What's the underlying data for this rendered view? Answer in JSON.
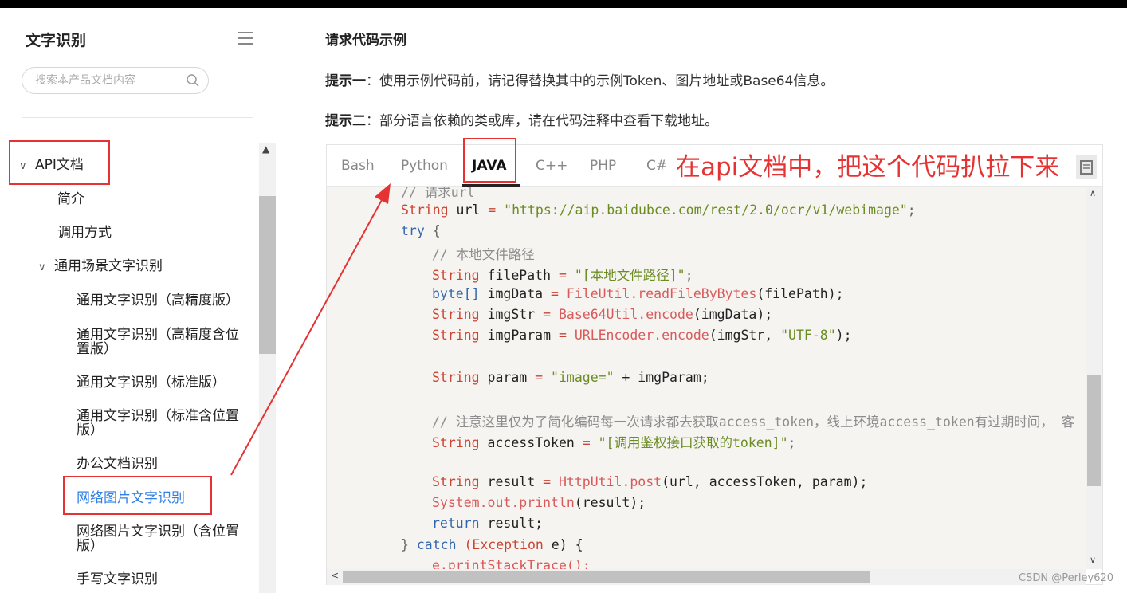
{
  "sidebar": {
    "title": "文字识别",
    "search_placeholder": "搜索本产品文档内容",
    "items": [
      {
        "label": "API文档"
      },
      {
        "label": "简介"
      },
      {
        "label": "调用方式"
      },
      {
        "label": "通用场景文字识别"
      },
      {
        "label": "通用文字识别（高精度版）"
      },
      {
        "label": "通用文字识别（高精度含位"
      },
      {
        "label": "置版）"
      },
      {
        "label": "通用文字识别（标准版）"
      },
      {
        "label": "通用文字识别（标准含位置"
      },
      {
        "label": "版）"
      },
      {
        "label": "办公文档识别"
      },
      {
        "label": "网络图片文字识别"
      },
      {
        "label": "网络图片文字识别（含位置"
      },
      {
        "label": "版）"
      },
      {
        "label": "手写文字识别"
      }
    ]
  },
  "main": {
    "section_title": "请求代码示例",
    "tip1_label": "提示一",
    "tip1_text": "：使用示例代码前，请记得替换其中的示例Token、图片地址或Base64信息。",
    "tip2_label": "提示二",
    "tip2_text": "：部分语言依赖的类或库，请在代码注释中查看下载地址。",
    "tabs": [
      "Bash",
      "Python",
      "JAVA",
      "C++",
      "PHP",
      "C#"
    ],
    "active_tab": "JAVA"
  },
  "code": {
    "l1": "// 请求url",
    "l2_type": "String",
    "l2_var": " url ",
    "l2_op": "=",
    "l2_str": " \"https://aip.baidubce.com/rest/2.0/ocr/v1/webimage\"",
    "l2_end": ";",
    "l3_kw": "try",
    "l3_end": " {",
    "l4": "// 本地文件路径",
    "l5_type": "String",
    "l5_var": " filePath ",
    "l5_op": "=",
    "l5_str": " \"[本地文件路径]\"",
    "l5_end": ";",
    "l6_type": "byte[]",
    "l6_var": " imgData ",
    "l6_op": "=",
    "l6_fn": " FileUtil.readFileByBytes",
    "l6_arg": "(filePath);",
    "l7_type": "String",
    "l7_var": " imgStr ",
    "l7_op": "=",
    "l7_fn": " Base64Util.encode",
    "l7_arg": "(imgData);",
    "l8_type": "String",
    "l8_var": " imgParam ",
    "l8_op": "=",
    "l8_fn": " URLEncoder.encode",
    "l8_arg": "(imgStr, ",
    "l8_str": "\"UTF-8\"",
    "l8_end": ");",
    "l9_type": "String",
    "l9_var": " param ",
    "l9_op": "=",
    "l9_str": " \"image=\"",
    "l9_rest": " + imgParam;",
    "l10": "// 注意这里仅为了简化编码每一次请求都去获取access_token，线上环境access_token有过期时间， 客",
    "l11_type": "String",
    "l11_var": " accessToken ",
    "l11_op": "=",
    "l11_str": " \"[调用鉴权接口获取的token]\"",
    "l11_end": ";",
    "l12_type": "String",
    "l12_var": " result ",
    "l12_op": "=",
    "l12_fn": " HttpUtil.post",
    "l12_arg": "(url, accessToken, param);",
    "l13_fn": "System.out.println",
    "l13_arg": "(result);",
    "l14_kw": "return",
    "l14_rest": " result;",
    "l15_a": "} ",
    "l15_kw": "catch",
    "l15_ty": " (Exception",
    "l15_rest": " e) {",
    "l16": "e.printStackTrace();"
  },
  "annotation": {
    "text": "在api文档中，把这个代码扒拉下来",
    "color": "#e53333"
  },
  "watermark": "CSDN @Perley620",
  "colors": {
    "accent": "#2f7fe4",
    "annotation_red": "#e53333",
    "code_bg": "#f6f4f1"
  }
}
